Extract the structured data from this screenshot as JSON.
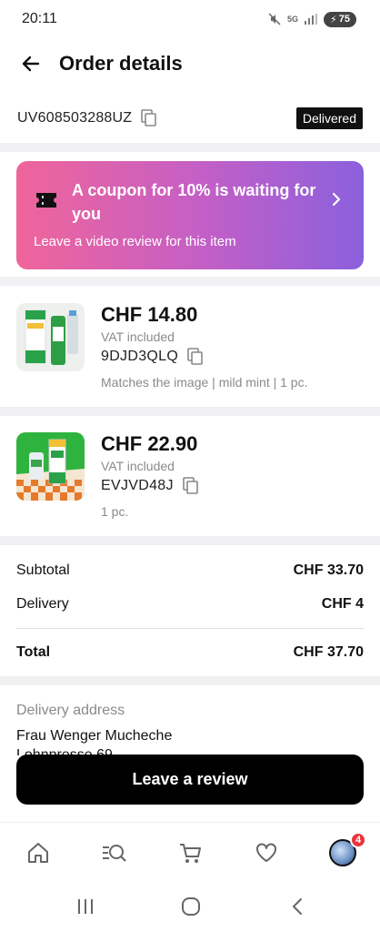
{
  "status_bar": {
    "time": "20:11",
    "network": "5G",
    "battery": "75"
  },
  "header": {
    "title": "Order details"
  },
  "order": {
    "id": "UV608503288UZ",
    "status": "Delivered"
  },
  "coupon": {
    "title": "A coupon for 10% is waiting for you",
    "subtitle": "Leave a video review for this item"
  },
  "products": [
    {
      "price": "CHF 14.80",
      "vat": "VAT included",
      "sku": "9DJD3QLQ",
      "variant": "Matches the image | mild mint | 1 pc."
    },
    {
      "price": "CHF 22.90",
      "vat": "VAT included",
      "sku": "EVJVD48J",
      "variant": "1 pc."
    }
  ],
  "summary": {
    "subtotal_label": "Subtotal",
    "subtotal_value": "CHF 33.70",
    "delivery_label": "Delivery",
    "delivery_value": "CHF 4",
    "total_label": "Total",
    "total_value": "CHF 37.70"
  },
  "address": {
    "label": "Delivery address",
    "name": "Frau Wenger Mucheche",
    "street": "Lohnpresse 69"
  },
  "review_button": {
    "label": "Leave a review"
  },
  "bottom_nav": {
    "items": [
      {
        "icon": "home-icon"
      },
      {
        "icon": "search-categories-icon"
      },
      {
        "icon": "cart-icon"
      },
      {
        "icon": "heart-icon"
      },
      {
        "icon": "profile-avatar",
        "badge": "4"
      }
    ]
  },
  "colors": {
    "coupon_gradient_start": "#f0659a",
    "coupon_gradient_end": "#8b60dd",
    "badge_red": "#e8343c",
    "separator": "#f1f1f3"
  }
}
